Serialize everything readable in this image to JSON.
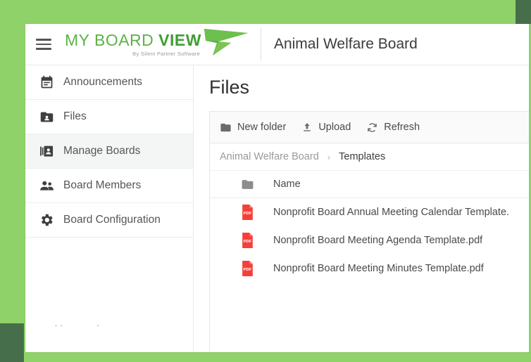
{
  "theme": {
    "bg_green": "#90d26a",
    "dark_green": "#476e4a",
    "logo_green": "#5cb247",
    "logo_green_bold": "#3f9e35",
    "pdf_red": "#f4403a",
    "active_row_bg": "#f4f6f6"
  },
  "topbar": {
    "menu_icon": "hamburger-icon",
    "logo": {
      "line1_light": "MY BOARD ",
      "line1_bold": "VIEW",
      "tagline": "By Silent Partner Software",
      "mark": "green-arrow-logo-mark"
    },
    "board_title": "Animal Welfare Board"
  },
  "sidebar": {
    "items": [
      {
        "label": "Announcements",
        "icon": "announcements-calendar-icon",
        "active": false
      },
      {
        "label": "Files",
        "icon": "files-folder-person-icon",
        "active": false
      },
      {
        "label": "Manage Boards",
        "icon": "manage-boards-icon",
        "active": true
      },
      {
        "label": "Board Members",
        "icon": "board-members-people-icon",
        "active": false
      },
      {
        "label": "Board Configuration",
        "icon": "gear-icon",
        "active": false
      }
    ]
  },
  "content": {
    "page_title": "Files",
    "toolbar": [
      {
        "label": "New folder",
        "icon": "folder-icon"
      },
      {
        "label": "Upload",
        "icon": "upload-arrow-icon"
      },
      {
        "label": "Refresh",
        "icon": "refresh-circular-arrow-icon"
      }
    ],
    "breadcrumb": {
      "separator": "›",
      "items": [
        {
          "label": "Animal Welfare Board",
          "current": false
        },
        {
          "label": "Templates",
          "current": true
        }
      ]
    },
    "table": {
      "header_icon": "folder-icon",
      "header_name": "Name",
      "rows": [
        {
          "name": "Nonprofit Board Annual Meeting Calendar Template.",
          "icon": "pdf-file-icon"
        },
        {
          "name": "Nonprofit Board Meeting Agenda Template.pdf",
          "icon": "pdf-file-icon"
        },
        {
          "name": "Nonprofit Board Meeting Minutes Template.pdf",
          "icon": "pdf-file-icon"
        }
      ]
    }
  }
}
